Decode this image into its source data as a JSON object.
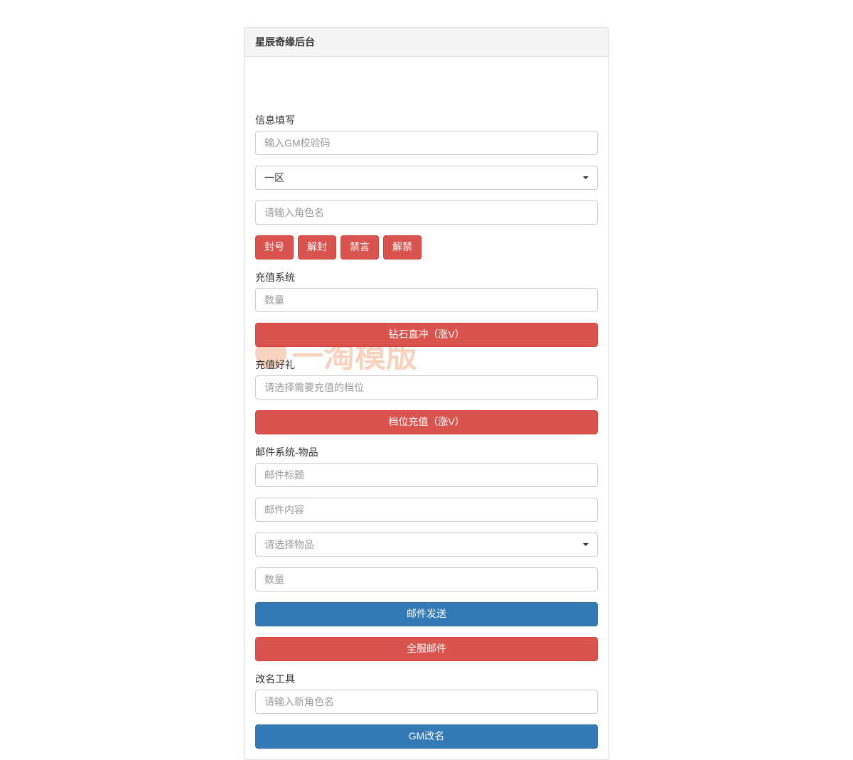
{
  "panel": {
    "title": "星辰奇缘后台"
  },
  "info_section": {
    "label": "信息填写",
    "gm_code_placeholder": "输入GM校验码",
    "zone_selected": "一区",
    "role_placeholder": "请输入角色名"
  },
  "action_buttons": {
    "ban": "封号",
    "unban": "解封",
    "mute": "禁言",
    "unmute": "解禁"
  },
  "recharge": {
    "label": "充值系统",
    "amount_placeholder": "数量",
    "diamond_button": "钻石直冲（涨V）"
  },
  "gift": {
    "label": "充值好礼",
    "tier_placeholder": "请选择需要充值的档位",
    "tier_button": "档位充值（涨V）"
  },
  "mail": {
    "label": "邮件系统-物品",
    "title_placeholder": "邮件标题",
    "content_placeholder": "邮件内容",
    "item_placeholder": "请选择物品",
    "amount_placeholder": "数量",
    "send_button": "邮件发送",
    "broadcast_button": "全服邮件"
  },
  "rename": {
    "label": "改名工具",
    "placeholder": "请输入新角色名",
    "button": "GM改名"
  },
  "watermark": "一淘模版"
}
